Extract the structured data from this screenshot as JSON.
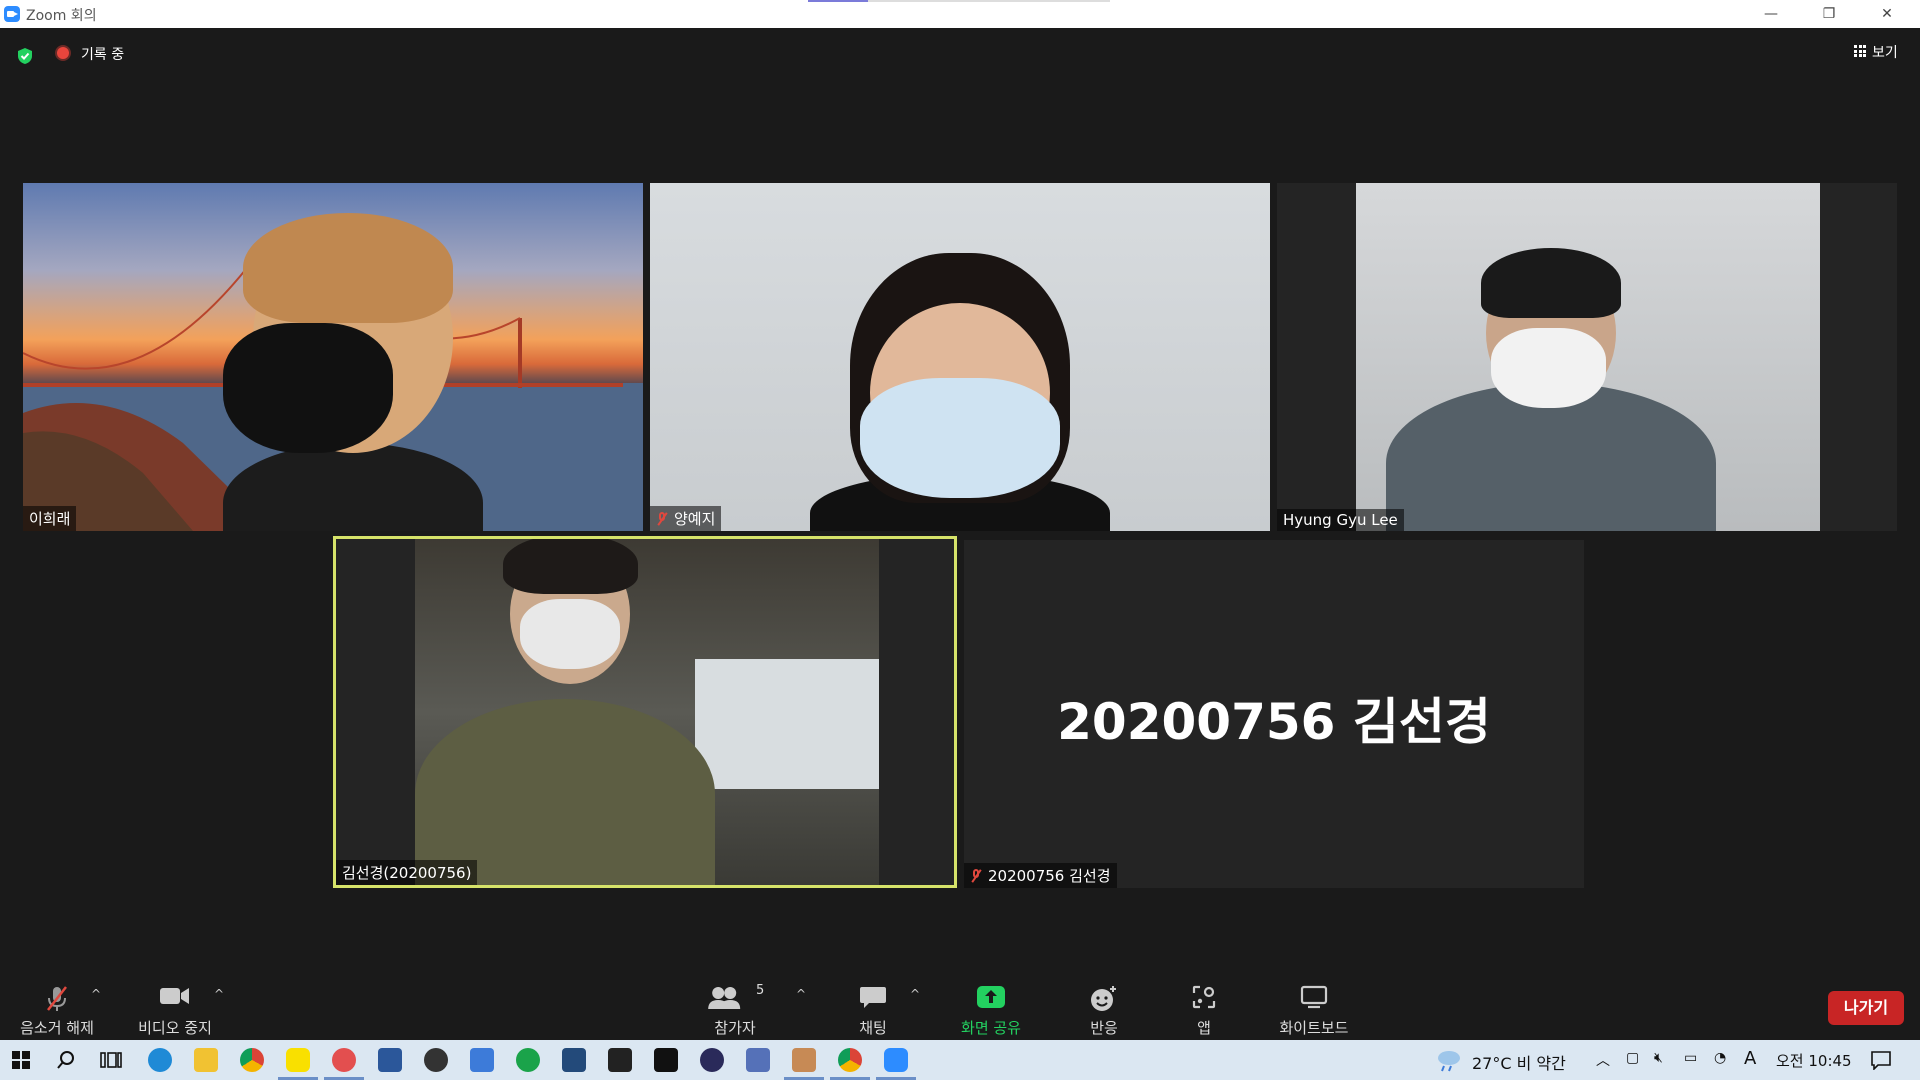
{
  "window": {
    "title": "Zoom 회의",
    "minimize": "—",
    "restore": "❐",
    "close": "✕"
  },
  "status": {
    "recording_label": "기록 중",
    "view_label": "보기"
  },
  "participants": [
    {
      "name": "이희래",
      "muted": false
    },
    {
      "name": "양예지",
      "muted": true
    },
    {
      "name": "Hyung Gyu Lee",
      "muted": false
    },
    {
      "name": "김선경(20200756)",
      "muted": false,
      "active_speaker": true
    },
    {
      "name": "20200756 김선경",
      "muted": true,
      "video_off_display": "20200756 김선경"
    }
  ],
  "toolbar": {
    "unmute": "음소거 해제",
    "stop_video": "비디오 중지",
    "participants": "참가자",
    "participant_count": "5",
    "chat": "채팅",
    "share_screen": "화면 공유",
    "reactions": "반응",
    "apps": "앱",
    "whiteboard": "화이트보드",
    "leave": "나가기",
    "caret": "^"
  },
  "taskbar": {
    "weather": "27°C  비 약간",
    "ime": "A",
    "time": "오전 10:45"
  },
  "colors": {
    "accent_green": "#23d160",
    "leave_red": "#c82525",
    "speaker_border": "#d6e36a",
    "mute_red": "#e0483e"
  }
}
